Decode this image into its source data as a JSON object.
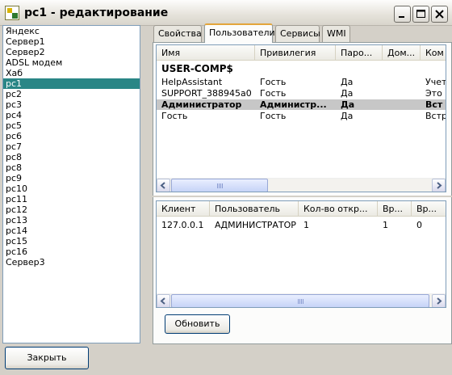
{
  "window": {
    "title": "pc1 - редактирование"
  },
  "devices": [
    "Яндекс",
    "Сервер1",
    "Сервер2",
    "ADSL модем",
    "Хаб",
    "pc1",
    "pc2",
    "pc3",
    "pc4",
    "pc5",
    "pc6",
    "pc7",
    "pc8",
    "pc8",
    "pc9",
    "pc10",
    "pc11",
    "pc12",
    "pc13",
    "pc14",
    "pc15",
    "pc16",
    "Сервер3"
  ],
  "selected_device_index": 5,
  "tabs": [
    {
      "label": "Свойства"
    },
    {
      "label": "Пользователи"
    },
    {
      "label": "Сервисы"
    },
    {
      "label": "WMI"
    }
  ],
  "active_tab": "Пользователи",
  "users_table": {
    "headers": [
      "Имя",
      "Привилегия",
      "Паро...",
      "Дом...",
      "Ком"
    ],
    "group": "USER-COMP$",
    "rows": [
      {
        "name": "HelpAssistant",
        "priv": "Гость",
        "pwd": "Да",
        "dom": "",
        "comment": "Учет"
      },
      {
        "name": "SUPPORT_388945a0",
        "priv": "Гость",
        "pwd": "Да",
        "dom": "",
        "comment": "Это"
      },
      {
        "name": "Администратор",
        "priv": "Администр...",
        "pwd": "Да",
        "dom": "",
        "comment": "Вст"
      },
      {
        "name": "Гость",
        "priv": "Гость",
        "pwd": "Да",
        "dom": "",
        "comment": "Встр"
      }
    ],
    "selected_row": 2
  },
  "sessions_table": {
    "headers": [
      "Клиент",
      "Пользователь",
      "Кол-во откр...",
      "Вр...",
      "Вр..."
    ],
    "rows": [
      {
        "client": "127.0.0.1",
        "user": "АДМИНИСТРАТОР",
        "open": "1",
        "t1": "1",
        "t2": "0"
      }
    ]
  },
  "buttons": {
    "refresh": "Обновить",
    "close": "Закрыть"
  },
  "scroll_icon": "scroll-grip-icon"
}
